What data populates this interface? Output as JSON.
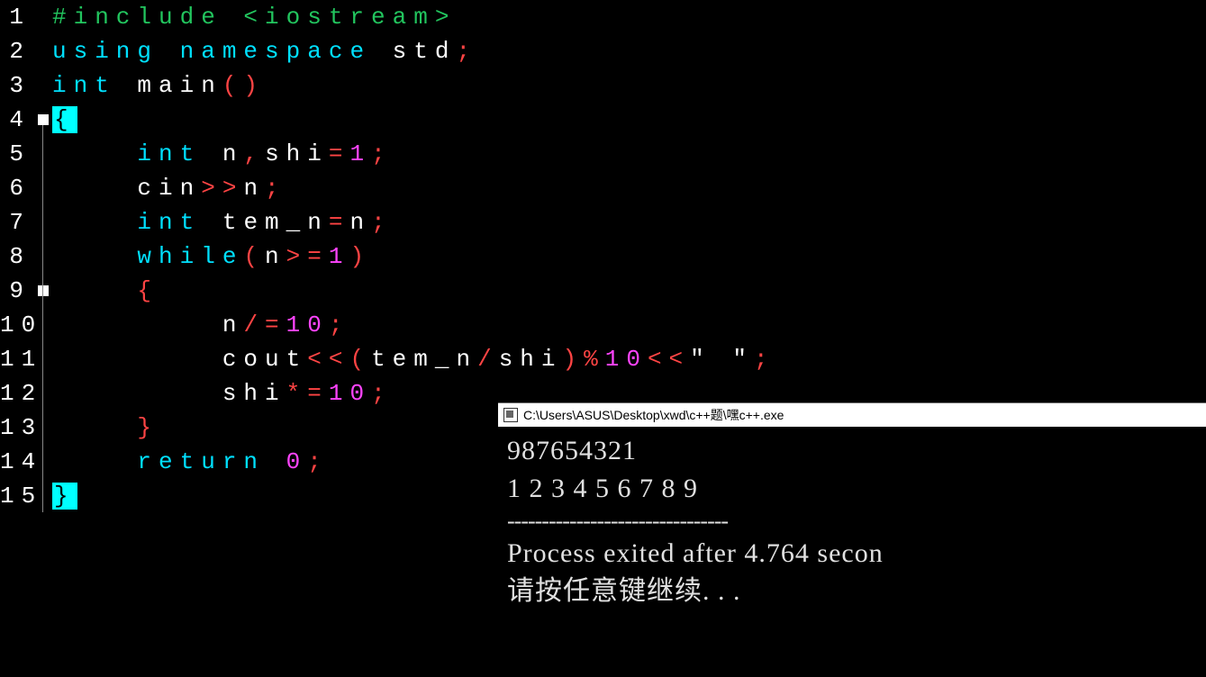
{
  "editor": {
    "lines": [
      {
        "num": "1",
        "tokens": [
          {
            "cls": "tok-preproc",
            "t": "#include <iostream>"
          }
        ]
      },
      {
        "num": "2",
        "tokens": [
          {
            "cls": "tok-keyword",
            "t": "using"
          },
          {
            "cls": "tok-ident",
            "t": " "
          },
          {
            "cls": "tok-keyword",
            "t": "namespace"
          },
          {
            "cls": "tok-ident",
            "t": " std"
          },
          {
            "cls": "tok-punct",
            "t": ";"
          }
        ]
      },
      {
        "num": "3",
        "tokens": [
          {
            "cls": "tok-keyword",
            "t": "int"
          },
          {
            "cls": "tok-ident",
            "t": " main"
          },
          {
            "cls": "tok-punct",
            "t": "()"
          }
        ]
      },
      {
        "num": "4",
        "fold": true,
        "tokens": [
          {
            "cls": "brace-hl",
            "t": "{"
          }
        ]
      },
      {
        "num": "5",
        "tokens": [
          {
            "cls": "tok-ident",
            "t": "    "
          },
          {
            "cls": "tok-keyword",
            "t": "int"
          },
          {
            "cls": "tok-ident",
            "t": " n"
          },
          {
            "cls": "tok-punct",
            "t": ","
          },
          {
            "cls": "tok-ident",
            "t": "shi"
          },
          {
            "cls": "tok-op",
            "t": "="
          },
          {
            "cls": "tok-num",
            "t": "1"
          },
          {
            "cls": "tok-punct",
            "t": ";"
          }
        ]
      },
      {
        "num": "6",
        "tokens": [
          {
            "cls": "tok-ident",
            "t": "    cin"
          },
          {
            "cls": "tok-op",
            "t": ">>"
          },
          {
            "cls": "tok-ident",
            "t": "n"
          },
          {
            "cls": "tok-punct",
            "t": ";"
          }
        ]
      },
      {
        "num": "7",
        "tokens": [
          {
            "cls": "tok-ident",
            "t": "    "
          },
          {
            "cls": "tok-keyword",
            "t": "int"
          },
          {
            "cls": "tok-ident",
            "t": " tem_n"
          },
          {
            "cls": "tok-op",
            "t": "="
          },
          {
            "cls": "tok-ident",
            "t": "n"
          },
          {
            "cls": "tok-punct",
            "t": ";"
          }
        ]
      },
      {
        "num": "8",
        "tokens": [
          {
            "cls": "tok-ident",
            "t": "    "
          },
          {
            "cls": "tok-keyword",
            "t": "while"
          },
          {
            "cls": "tok-punct",
            "t": "("
          },
          {
            "cls": "tok-ident",
            "t": "n"
          },
          {
            "cls": "tok-op",
            "t": ">="
          },
          {
            "cls": "tok-num",
            "t": "1"
          },
          {
            "cls": "tok-punct",
            "t": ")"
          }
        ]
      },
      {
        "num": "9",
        "fold": true,
        "tokens": [
          {
            "cls": "tok-ident",
            "t": "    "
          },
          {
            "cls": "tok-punct",
            "t": "{"
          }
        ]
      },
      {
        "num": "10",
        "tokens": [
          {
            "cls": "tok-ident",
            "t": "        n"
          },
          {
            "cls": "tok-op",
            "t": "/="
          },
          {
            "cls": "tok-num",
            "t": "10"
          },
          {
            "cls": "tok-punct",
            "t": ";"
          }
        ]
      },
      {
        "num": "11",
        "tokens": [
          {
            "cls": "tok-ident",
            "t": "        cout"
          },
          {
            "cls": "tok-op",
            "t": "<<"
          },
          {
            "cls": "tok-punct",
            "t": "("
          },
          {
            "cls": "tok-ident",
            "t": "tem_n"
          },
          {
            "cls": "tok-op",
            "t": "/"
          },
          {
            "cls": "tok-ident",
            "t": "shi"
          },
          {
            "cls": "tok-punct",
            "t": ")"
          },
          {
            "cls": "tok-op",
            "t": "%"
          },
          {
            "cls": "tok-num",
            "t": "10"
          },
          {
            "cls": "tok-op",
            "t": "<<"
          },
          {
            "cls": "tok-string",
            "t": "\" \""
          },
          {
            "cls": "tok-punct",
            "t": ";"
          }
        ]
      },
      {
        "num": "12",
        "tokens": [
          {
            "cls": "tok-ident",
            "t": "        shi"
          },
          {
            "cls": "tok-op",
            "t": "*="
          },
          {
            "cls": "tok-num",
            "t": "10"
          },
          {
            "cls": "tok-punct",
            "t": ";"
          }
        ]
      },
      {
        "num": "13",
        "tokens": [
          {
            "cls": "tok-ident",
            "t": "    "
          },
          {
            "cls": "tok-punct",
            "t": "}"
          }
        ]
      },
      {
        "num": "14",
        "tokens": [
          {
            "cls": "tok-ident",
            "t": "    "
          },
          {
            "cls": "tok-keyword",
            "t": "return"
          },
          {
            "cls": "tok-ident",
            "t": " "
          },
          {
            "cls": "tok-num",
            "t": "0"
          },
          {
            "cls": "tok-punct",
            "t": ";"
          }
        ]
      },
      {
        "num": "15",
        "tokens": [
          {
            "cls": "brace-hl",
            "t": "}"
          }
        ]
      }
    ]
  },
  "console": {
    "title": "C:\\Users\\ASUS\\Desktop\\xwd\\c++题\\嘿c++.exe",
    "line1": "987654321",
    "line2": "1 2 3 4 5 6 7 8 9",
    "divider": "--------------------------------",
    "line3": "Process exited after 4.764 secon",
    "line4": "请按任意键继续. . ."
  }
}
